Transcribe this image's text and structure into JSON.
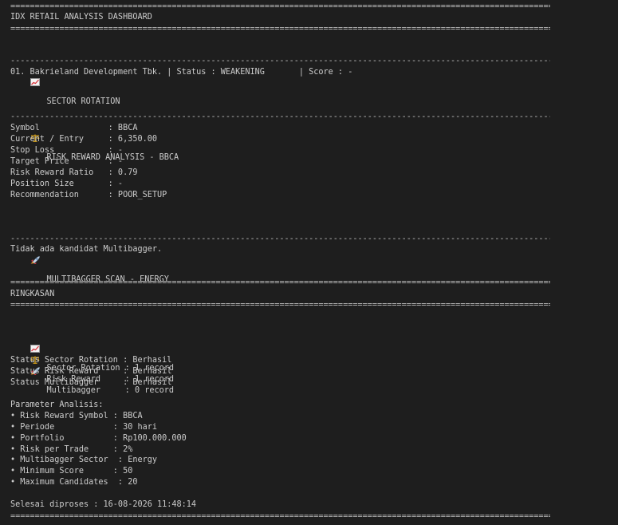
{
  "rules": {
    "double": "========================================================================================================================",
    "single": "------------------------------------------------------------------------------------------------------------------------"
  },
  "header": {
    "title": "IDX RETAIL ANALYSIS DASHBOARD"
  },
  "sector_rotation": {
    "icon": "chart-increasing-icon",
    "heading": "SECTOR ROTATION",
    "row": "01. Bakrieland Development Tbk. | Status : WEAKENING       | Score : -"
  },
  "risk_reward": {
    "icon": "balance-scale-icon",
    "heading": "RISK REWARD ANALYSIS - BBCA",
    "lines": [
      "Symbol              : BBCA",
      "Current / Entry     : 6,350.00",
      "Stop Loss           : -",
      "Target Price        : -",
      "Risk Reward Ratio   : 0.79",
      "Position Size       : -",
      "Recommendation      : POOR_SETUP"
    ]
  },
  "multibagger": {
    "icon": "rocket-icon",
    "heading": "MULTIBAGGER SCAN - ENERGY",
    "message": "Tidak ada kandidat Multibagger."
  },
  "summary": {
    "heading": "RINGKASAN",
    "records": [
      "Sector Rotation : 1 record",
      "Risk Reward     : 1 record",
      "Multibagger     : 0 record"
    ],
    "statuses": [
      "Status Sector Rotation : Berhasil",
      "Status Risk Reward     : Berhasil",
      "Status Multibagger     : Berhasil"
    ],
    "params_heading": "Parameter Analisis:",
    "params": [
      "• Risk Reward Symbol : BBCA",
      "• Periode            : 30 hari",
      "• Portfolio          : Rp100.000.000",
      "• Risk per Trade     : 2%",
      "• Multibagger Sector  : Energy",
      "• Minimum Score      : 50",
      "• Maximum Candidates  : 20"
    ],
    "finished": "Selesai diproses : 16-08-2026 11:48:14"
  }
}
